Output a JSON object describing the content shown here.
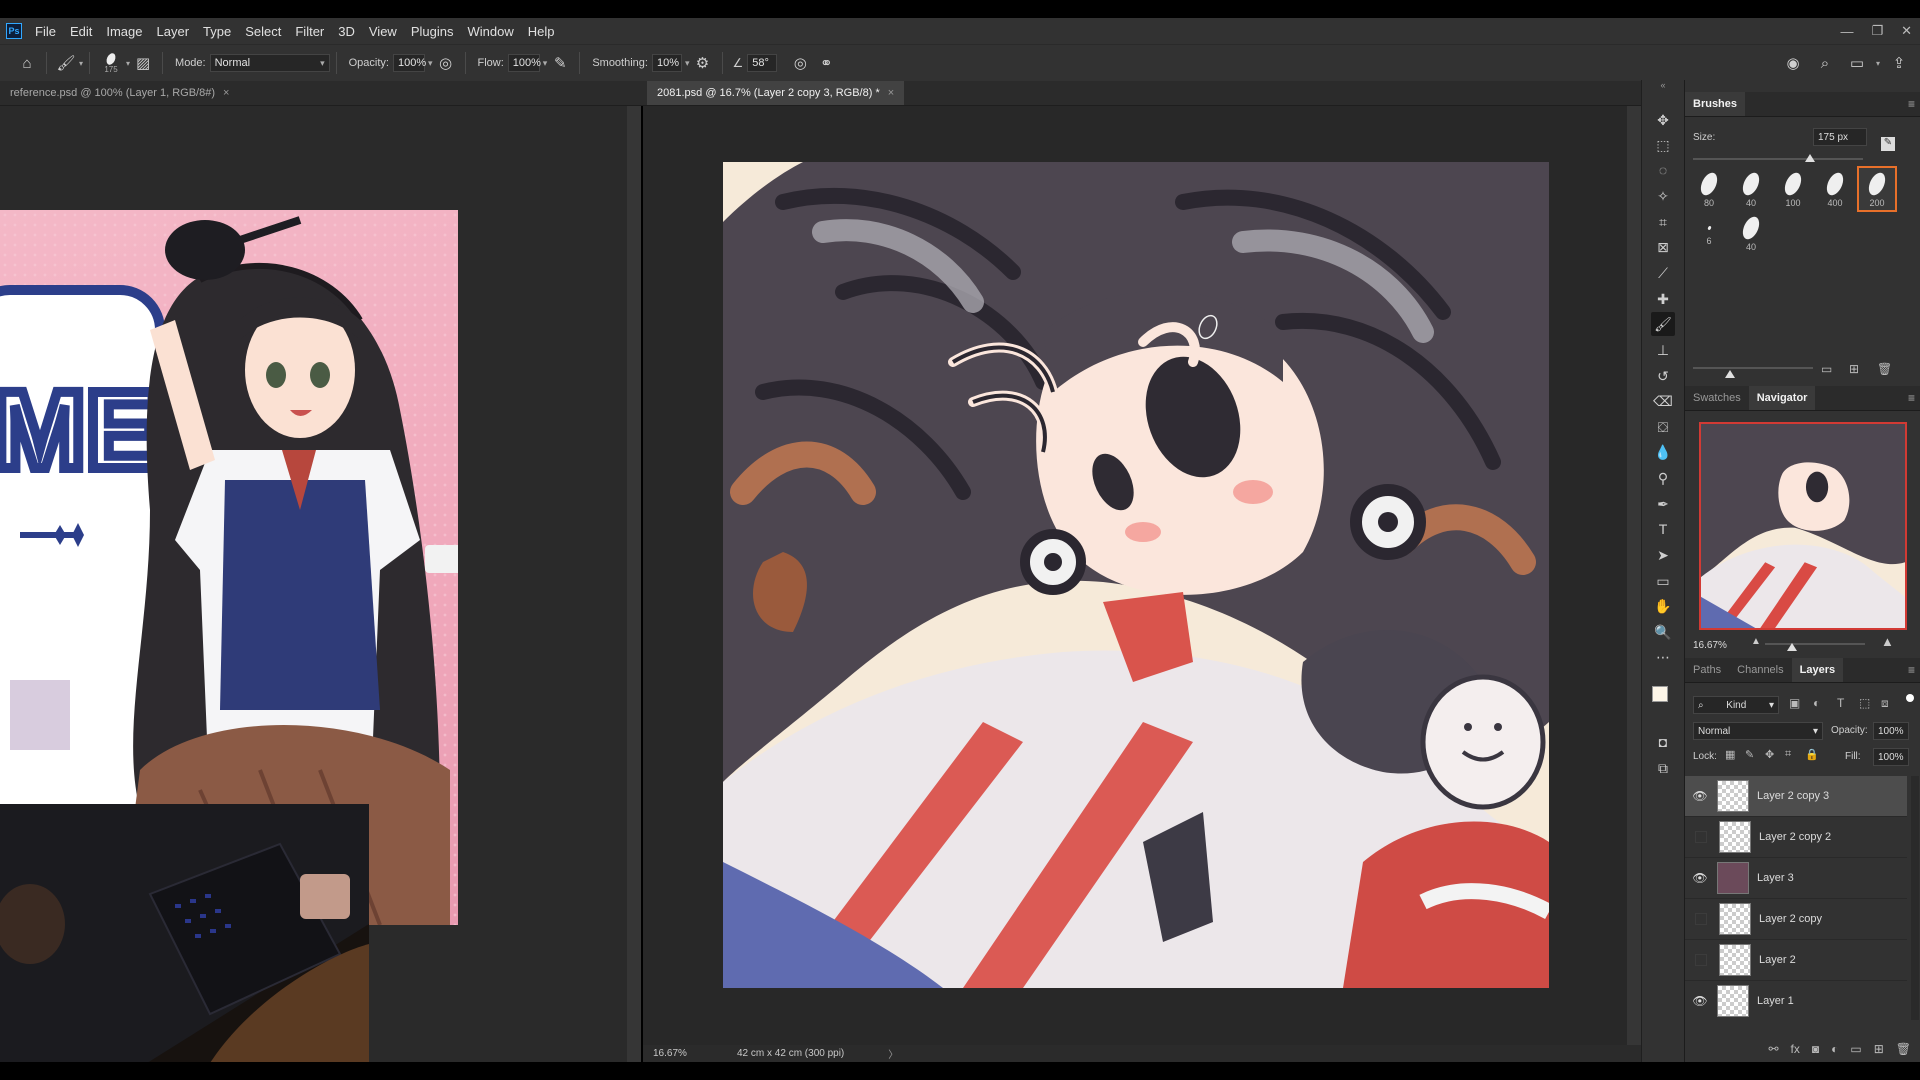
{
  "menu": {
    "logo": "Ps",
    "items": [
      "File",
      "Edit",
      "Image",
      "Layer",
      "Type",
      "Select",
      "Filter",
      "3D",
      "View",
      "Plugins",
      "Window",
      "Help"
    ],
    "window_controls": {
      "minimize": "—",
      "restore": "❐",
      "close": "✕"
    }
  },
  "options": {
    "brush_size": "175",
    "mode_label": "Mode:",
    "mode_value": "Normal",
    "opacity_label": "Opacity:",
    "opacity_value": "100%",
    "flow_label": "Flow:",
    "flow_value": "100%",
    "smoothing_label": "Smoothing:",
    "smoothing_value": "10%",
    "angle_value": "58°"
  },
  "tabs": {
    "reference": "reference.psd @ 100% (Layer 1, RGB/8#)",
    "main": "2081.psd @ 16.7% (Layer 2 copy 3, RGB/8) *",
    "close": "×"
  },
  "status": {
    "zoom": "16.67%",
    "doc_info": "42 cm x 42 cm (300 ppi)",
    "arrow": "〉"
  },
  "brushes": {
    "title": "Brushes",
    "size_label": "Size:",
    "size_value": "175 px",
    "presets": [
      "80",
      "40",
      "100",
      "400",
      "200",
      "6",
      "40"
    ]
  },
  "navigator": {
    "tabs": [
      "Swatches",
      "Navigator"
    ],
    "zoom": "16.67%"
  },
  "layers": {
    "tabs": [
      "Paths",
      "Channels",
      "Layers"
    ],
    "filter_kind": "Kind",
    "blend_mode": "Normal",
    "opacity_label": "Opacity:",
    "opacity_value": "100%",
    "lock_label": "Lock:",
    "fill_label": "Fill:",
    "fill_value": "100%",
    "items": [
      {
        "name": "Layer 2 copy 3",
        "visible": true,
        "selected": true
      },
      {
        "name": "Layer 2 copy 2",
        "visible": false,
        "selected": false
      },
      {
        "name": "Layer 3",
        "visible": true,
        "selected": false
      },
      {
        "name": "Layer 2 copy",
        "visible": false,
        "selected": false
      },
      {
        "name": "Layer 2",
        "visible": false,
        "selected": false
      },
      {
        "name": "Layer 1",
        "visible": true,
        "selected": false
      }
    ]
  },
  "colors": {
    "accent": "#e8702a",
    "ui_bg": "#323232",
    "canvas_red": "#d94a44",
    "canvas_dark": "#4b454f"
  },
  "reference_art": {
    "logo_text": "ME"
  }
}
